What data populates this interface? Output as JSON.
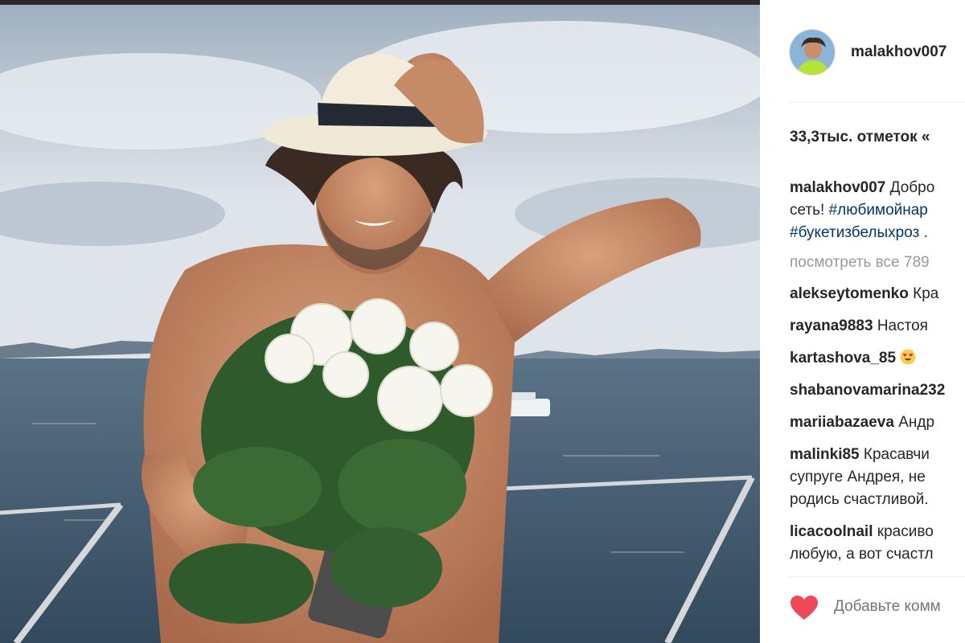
{
  "post": {
    "username": "malakhov007",
    "likes": "33,3тыс. отметок «",
    "caption": {
      "username": "malakhov007",
      "line1_text": "Добро",
      "line2_text": "сеть! ",
      "line2_hashtag": "#любимойнар",
      "line3_hashtag": "#букетизбелыхроз",
      "line3_text": " ."
    },
    "view_all": "посмотреть все 789",
    "comments": [
      {
        "username": "alekseytomenko",
        "text": "Кра"
      },
      {
        "username": "rayana9883",
        "text": "Настоя"
      },
      {
        "username": "kartashova_85",
        "text": "",
        "emoji": "heart-eyes-emoji"
      },
      {
        "username": "shabanovamarina232",
        "text": ""
      },
      {
        "username": "mariiabazaeva",
        "text": "Андр"
      },
      {
        "username": "malinki85",
        "text": "Красавчи",
        "text2": "супруге Андрея, не",
        "text3": "родись счастливой."
      },
      {
        "username": "licacoolnail",
        "text": "красиво",
        "text2": "любую, а вот счастл"
      }
    ],
    "add_comment_placeholder": "Добавьте комм",
    "like_icon": "heart-icon",
    "like_color": "#ed4956"
  }
}
